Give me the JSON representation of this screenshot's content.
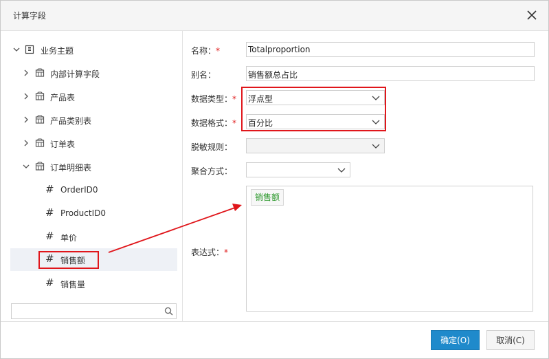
{
  "dialog": {
    "title": "计算字段"
  },
  "tree": {
    "root": "业务主题",
    "tables": [
      {
        "label": "内部计算字段"
      },
      {
        "label": "产品表"
      },
      {
        "label": "产品类别表"
      },
      {
        "label": "订单表"
      },
      {
        "label": "订单明细表"
      }
    ],
    "fields": [
      {
        "label": "OrderID0"
      },
      {
        "label": "ProductID0"
      },
      {
        "label": "单价"
      },
      {
        "label": "销售额"
      },
      {
        "label": "销售量"
      }
    ],
    "search_placeholder": ""
  },
  "form": {
    "name_label": "名称：",
    "name_value": "Totalproportion",
    "alias_label": "别名：",
    "alias_value": "销售额总占比",
    "datatype_label": "数据类型：",
    "datatype_value": "浮点型",
    "format_label": "数据格式：",
    "format_value": "百分比",
    "mask_label": "脱敏规则：",
    "mask_value": "",
    "agg_label": "聚合方式：",
    "agg_value": "",
    "expr_label": "表达式：",
    "expr_token": "销售额",
    "required_mark": "*"
  },
  "footer": {
    "ok_label": "确定(O)",
    "cancel_label": "取消(C)"
  },
  "colors": {
    "primary": "#1f8acb",
    "highlight": "#e0161b",
    "token_text": "#2f9a2f"
  }
}
